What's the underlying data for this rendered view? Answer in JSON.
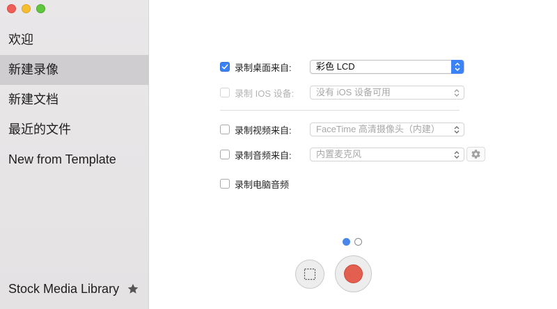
{
  "sidebar": {
    "items": [
      {
        "label": "欢迎"
      },
      {
        "label": "新建录像"
      },
      {
        "label": "新建文档"
      },
      {
        "label": "最近的文件"
      },
      {
        "label": "New from Template"
      }
    ],
    "selected_index": 1,
    "footer_label": "Stock Media Library",
    "footer_icon": "star-icon"
  },
  "options": {
    "desktop": {
      "label": "录制桌面来自:",
      "value": "彩色 LCD",
      "checked": true
    },
    "ios": {
      "label": "录制 IOS 设备:",
      "value": "没有 iOS 设备可用",
      "checked": false,
      "disabled": true
    },
    "video": {
      "label": "录制视频来自:",
      "value": "FaceTime 高清摄像头（内建）",
      "checked": false
    },
    "audio": {
      "label": "录制音频来自:",
      "value": "内置麦克风",
      "checked": false
    },
    "computer_audio": {
      "label": "录制电脑音频",
      "checked": false
    }
  },
  "pagination": {
    "current": 1,
    "total": 2
  },
  "colors": {
    "accent": "#3b82f6",
    "record": "#e35f4f"
  }
}
